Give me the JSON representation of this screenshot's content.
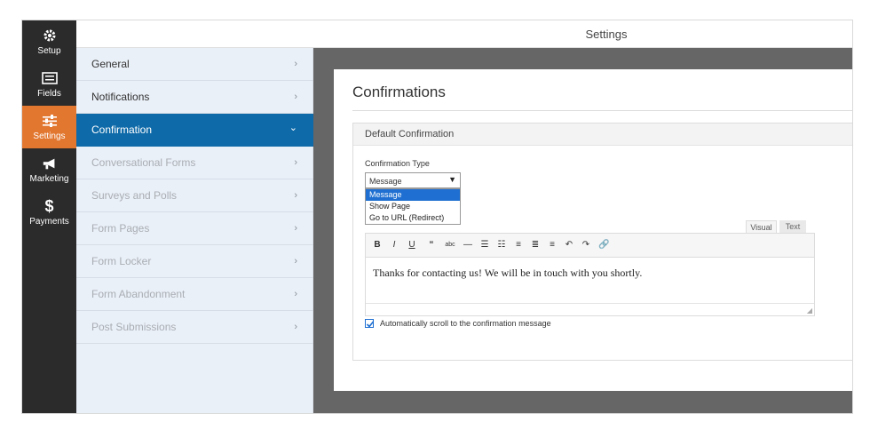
{
  "header": {
    "title": "Settings"
  },
  "nav": [
    {
      "label": "Setup",
      "icon": "gear-icon",
      "active": false
    },
    {
      "label": "Fields",
      "icon": "list-icon",
      "active": false
    },
    {
      "label": "Settings",
      "icon": "sliders-icon",
      "active": true
    },
    {
      "label": "Marketing",
      "icon": "megaphone-icon",
      "active": false
    },
    {
      "label": "Payments",
      "icon": "dollar-icon",
      "active": false
    }
  ],
  "menu": [
    {
      "label": "General",
      "chevron": "›"
    },
    {
      "label": "Notifications",
      "chevron": "›"
    },
    {
      "label": "Confirmation",
      "chevron": "⌄"
    },
    {
      "label": "Conversational Forms",
      "chevron": "›"
    },
    {
      "label": "Surveys and Polls",
      "chevron": "›"
    },
    {
      "label": "Form Pages",
      "chevron": "›"
    },
    {
      "label": "Form Locker",
      "chevron": "›"
    },
    {
      "label": "Form Abandonment",
      "chevron": "›"
    },
    {
      "label": "Post Submissions",
      "chevron": "›"
    }
  ],
  "main": {
    "title": "Confirmations",
    "panel_title": "Default Confirmation",
    "type_label": "Confirmation Type",
    "select_value": "Message",
    "options": [
      "Message",
      "Show Page",
      "Go to URL (Redirect)"
    ],
    "tabs": {
      "visual": "Visual",
      "text": "Text"
    },
    "message": "Thanks for contacting us! We will be in touch with you shortly.",
    "checkbox_label": "Automatically scroll to the confirmation message",
    "checkbox_checked": true
  },
  "colors": {
    "accent": "#e27730",
    "active_menu": "#0e6aa9",
    "nav_bg": "#2b2b2b",
    "selected_option": "#1e6fd1"
  }
}
